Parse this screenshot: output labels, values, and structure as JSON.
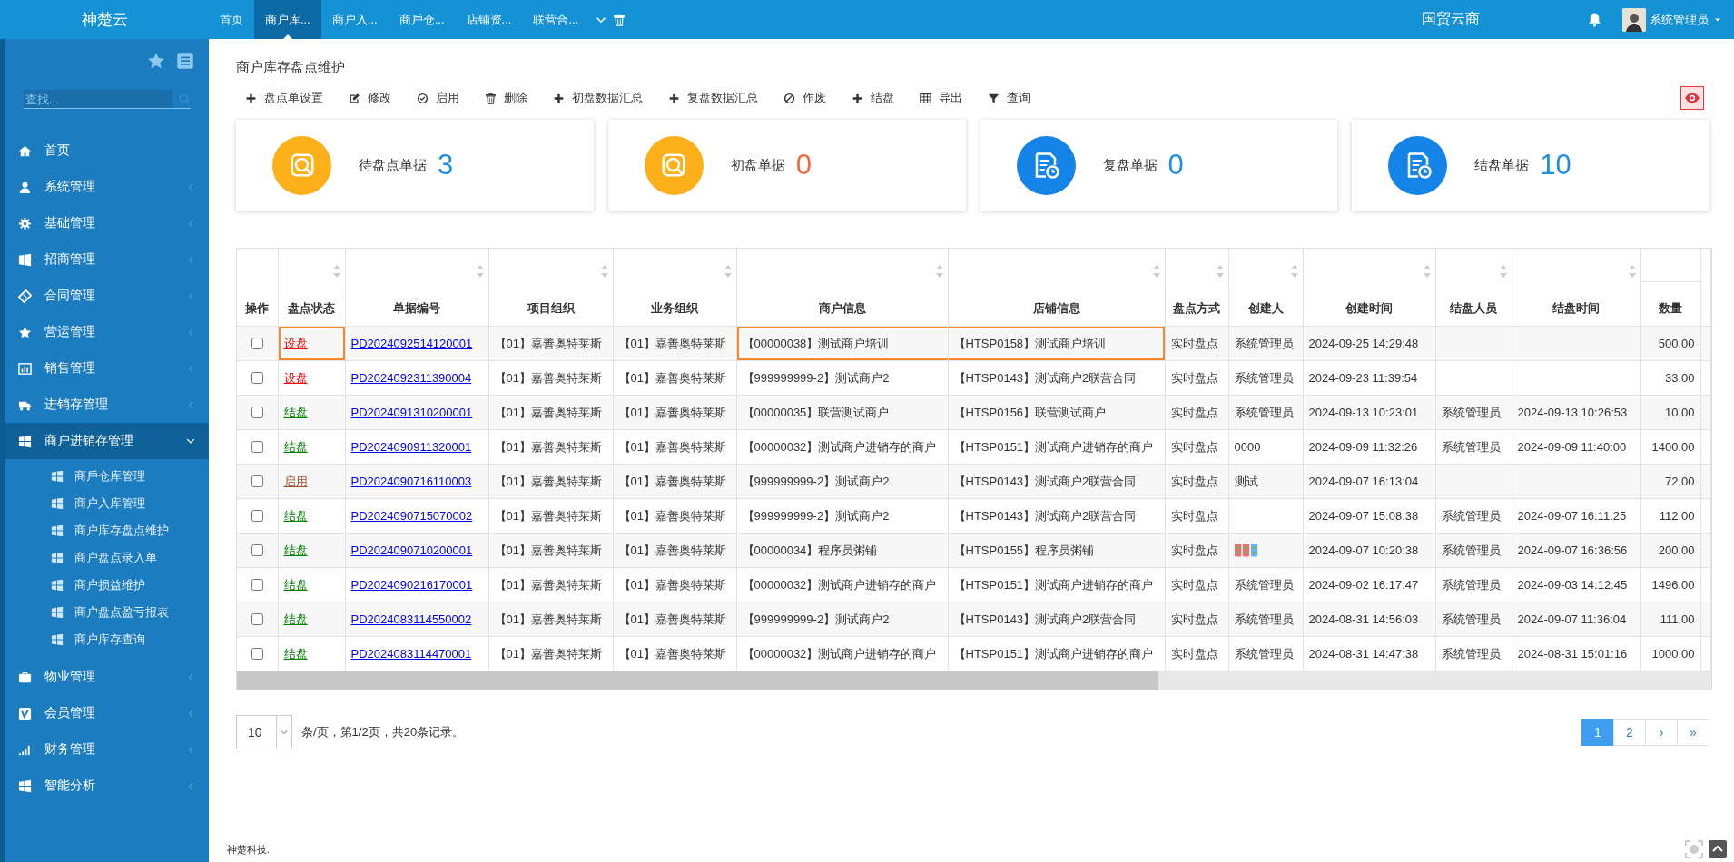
{
  "topbar": {
    "logo": "神楚云",
    "tabs": [
      {
        "label": "首页",
        "selected": false
      },
      {
        "label": "商户库...",
        "selected": true
      },
      {
        "label": "商户入...",
        "selected": false
      },
      {
        "label": "商戶仓...",
        "selected": false
      },
      {
        "label": "店铺资...",
        "selected": false
      },
      {
        "label": "联营合...",
        "selected": false
      }
    ],
    "brand": "国贸云商",
    "user": "系统管理员"
  },
  "sidebar": {
    "search_placeholder": "查找...",
    "items": [
      {
        "label": "首页"
      },
      {
        "label": "系统管理",
        "expanded": false
      },
      {
        "label": "基础管理",
        "expanded": false
      },
      {
        "label": "招商管理",
        "expanded": false
      },
      {
        "label": "合同管理",
        "expanded": false
      },
      {
        "label": "营运管理",
        "expanded": false
      },
      {
        "label": "销售管理",
        "expanded": false
      },
      {
        "label": "进销存管理",
        "expanded": false
      },
      {
        "label": "商户进销存管理",
        "expanded": true,
        "children": [
          {
            "label": "商戶仓库管理"
          },
          {
            "label": "商户入库管理"
          },
          {
            "label": "商户库存盘点维护"
          },
          {
            "label": "商户盘点录入单"
          },
          {
            "label": "商户损益维护"
          },
          {
            "label": "商户盘点盈亏报表"
          },
          {
            "label": "商户库存查询"
          }
        ]
      },
      {
        "label": "物业管理",
        "expanded": false
      },
      {
        "label": "会员管理",
        "expanded": false
      },
      {
        "label": "财务管理",
        "expanded": false
      },
      {
        "label": "智能分析",
        "expanded": false
      }
    ]
  },
  "page": {
    "title": "商户库存盘点维护",
    "toolbar": [
      {
        "label": "盘点单设置"
      },
      {
        "label": "修改"
      },
      {
        "label": "启用"
      },
      {
        "label": "删除"
      },
      {
        "label": "初盘数据汇总"
      },
      {
        "label": "复盘数据汇总"
      },
      {
        "label": "作废"
      },
      {
        "label": "结盘"
      },
      {
        "label": "导出"
      },
      {
        "label": "查询"
      }
    ]
  },
  "cards": [
    {
      "label": "待盘点单据",
      "count": "3",
      "color": "#1b8fe6"
    },
    {
      "label": "初盘单据",
      "count": "0",
      "color": "#f4683c"
    },
    {
      "label": "复盘单据",
      "count": "0",
      "color": "#1b8fe6"
    },
    {
      "label": "结盘单据",
      "count": "10",
      "color": "#1b8fe6"
    }
  ],
  "table": {
    "columns": [
      {
        "label": "操作",
        "sortable": false
      },
      {
        "label": "盘点状态",
        "sortable": true
      },
      {
        "label": "单据编号",
        "sortable": true
      },
      {
        "label": "项目组织",
        "sortable": true
      },
      {
        "label": "业务组织",
        "sortable": true
      },
      {
        "label": "商户信息",
        "sortable": true
      },
      {
        "label": "店铺信息",
        "sortable": true
      },
      {
        "label": "盘点方式",
        "sortable": true
      },
      {
        "label": "创建人",
        "sortable": true
      },
      {
        "label": "创建时间",
        "sortable": true
      },
      {
        "label": "结盘人员",
        "sortable": true
      },
      {
        "label": "结盘时间",
        "sortable": true
      },
      {
        "label": "数量",
        "sortable": false
      }
    ],
    "rows": [
      {
        "checked": false,
        "highlighted": true,
        "status": "设盘",
        "color": "#ff0000",
        "number": "PD2024092514120001",
        "project": "【01】嘉善奥特莱斯",
        "business": "【01】嘉善奥特莱斯",
        "merchant": "【00000038】测试商户培训",
        "shop": "【HTSP0158】测试商户培训",
        "method": "实时盘点",
        "creator": "系统管理员",
        "created": "2024-09-25 14:29:48",
        "quantity": "500.00"
      },
      {
        "checked": false,
        "highlighted": false,
        "status": "设盘",
        "color": "#ff0000",
        "number": "PD2024092311390004",
        "project": "【01】嘉善奥特莱斯",
        "business": "【01】嘉善奥特莱斯",
        "merchant": "【999999999-2】测试商户2",
        "shop": "【HTSP0143】测试商户2联营合同",
        "method": "实时盘点",
        "creator": "系统管理员",
        "created": "2024-09-23 11:39:54",
        "quantity": "33.00"
      },
      {
        "checked": false,
        "highlighted": false,
        "status": "结盘",
        "color": "#008000",
        "number": "PD2024091310200001",
        "project": "【01】嘉善奥特莱斯",
        "business": "【01】嘉善奥特莱斯",
        "merchant": "【00000035】联营测试商户",
        "shop": "【HTSP0156】联营测试商户",
        "method": "实时盘点",
        "creator": "系统管理员",
        "created": "2024-09-13 10:23:01",
        "closer": "系统管理员",
        "closed": "2024-09-13 10:26:53",
        "quantity": "10.00"
      },
      {
        "checked": false,
        "highlighted": false,
        "status": "结盘",
        "color": "#008000",
        "number": "PD2024090911320001",
        "project": "【01】嘉善奥特莱斯",
        "business": "【01】嘉善奥特莱斯",
        "merchant": "【00000032】测试商户进销存的商户",
        "shop": "【HTSP0151】测试商户进销存的商户",
        "method": "实时盘点",
        "creator": "0000",
        "created": "2024-09-09 11:32:26",
        "closer": "系统管理员",
        "closed": "2024-09-09 11:40:00",
        "quantity": "1400.00"
      },
      {
        "checked": false,
        "highlighted": false,
        "status": "启用",
        "color": "#a0522d",
        "number": "PD2024090716110003",
        "project": "【01】嘉善奥特莱斯",
        "business": "【01】嘉善奥特莱斯",
        "merchant": "【999999999-2】测试商户2",
        "shop": "【HTSP0143】测试商户2联营合同",
        "method": "实时盘点",
        "creator": "测试",
        "created": "2024-09-07 16:13:04",
        "quantity": "72.00"
      },
      {
        "checked": false,
        "highlighted": false,
        "status": "结盘",
        "color": "#008000",
        "number": "PD2024090715070002",
        "project": "【01】嘉善奥特莱斯",
        "business": "【01】嘉善奥特莱斯",
        "merchant": "【999999999-2】测试商户2",
        "shop": "【HTSP0143】测试商户2联营合同",
        "method": "实时盘点",
        "created": "2024-09-07 15:08:38",
        "closer": "系统管理员",
        "closed": "2024-09-07 16:11:25",
        "quantity": "112.00"
      },
      {
        "checked": false,
        "highlighted": false,
        "status": "结盘",
        "color": "#008000",
        "number": "PD2024090710200001",
        "project": "【01】嘉善奥特莱斯",
        "business": "【01】嘉善奥特莱斯",
        "merchant": "【00000034】程序员粥铺",
        "shop": "【HTSP0155】程序员粥铺",
        "method": "实时盘点",
        "kind": "icons",
        "created": "2024-09-07 10:20:38",
        "closer": "系统管理员",
        "closed": "2024-09-07 16:36:56",
        "quantity": "200.00"
      },
      {
        "checked": false,
        "highlighted": false,
        "status": "结盘",
        "color": "#008000",
        "number": "PD2024090216170001",
        "project": "【01】嘉善奥特莱斯",
        "business": "【01】嘉善奥特莱斯",
        "merchant": "【00000032】测试商户进销存的商户",
        "shop": "【HTSP0151】测试商户进销存的商户",
        "method": "实时盘点",
        "creator": "系统管理员",
        "created": "2024-09-02 16:17:47",
        "closer": "系统管理员",
        "closed": "2024-09-03 14:12:45",
        "quantity": "1496.00"
      },
      {
        "checked": false,
        "highlighted": false,
        "status": "结盘",
        "color": "#008000",
        "number": "PD2024083114550002",
        "project": "【01】嘉善奥特莱斯",
        "business": "【01】嘉善奥特莱斯",
        "merchant": "【999999999-2】测试商户2",
        "shop": "【HTSP0143】测试商户2联营合同",
        "method": "实时盘点",
        "creator": "系统管理员",
        "created": "2024-08-31 14:56:03",
        "closer": "系统管理员",
        "closed": "2024-09-07 11:36:04",
        "quantity": "111.00"
      },
      {
        "checked": false,
        "highlighted": false,
        "status": "结盘",
        "color": "#008000",
        "number": "PD2024083114470001",
        "project": "【01】嘉善奥特莱斯",
        "business": "【01】嘉善奥特莱斯",
        "merchant": "【00000032】测试商户进销存的商户",
        "shop": "【HTSP0151】测试商户进销存的商户",
        "method": "实时盘点",
        "creator": "系统管理员",
        "created": "2024-08-31 14:47:38",
        "closer": "系统管理员",
        "closed": "2024-08-31 15:01:16",
        "quantity": "1000.00"
      }
    ]
  },
  "pager": {
    "page_size": "10",
    "summary": "条/页，第1/2页，共20条记录。",
    "pages": [
      {
        "label": "1",
        "selected": true
      },
      {
        "label": "2",
        "selected": false
      },
      {
        "label": "›",
        "selected": false
      },
      {
        "label": "»",
        "selected": false
      }
    ]
  },
  "footer": "神楚科技."
}
